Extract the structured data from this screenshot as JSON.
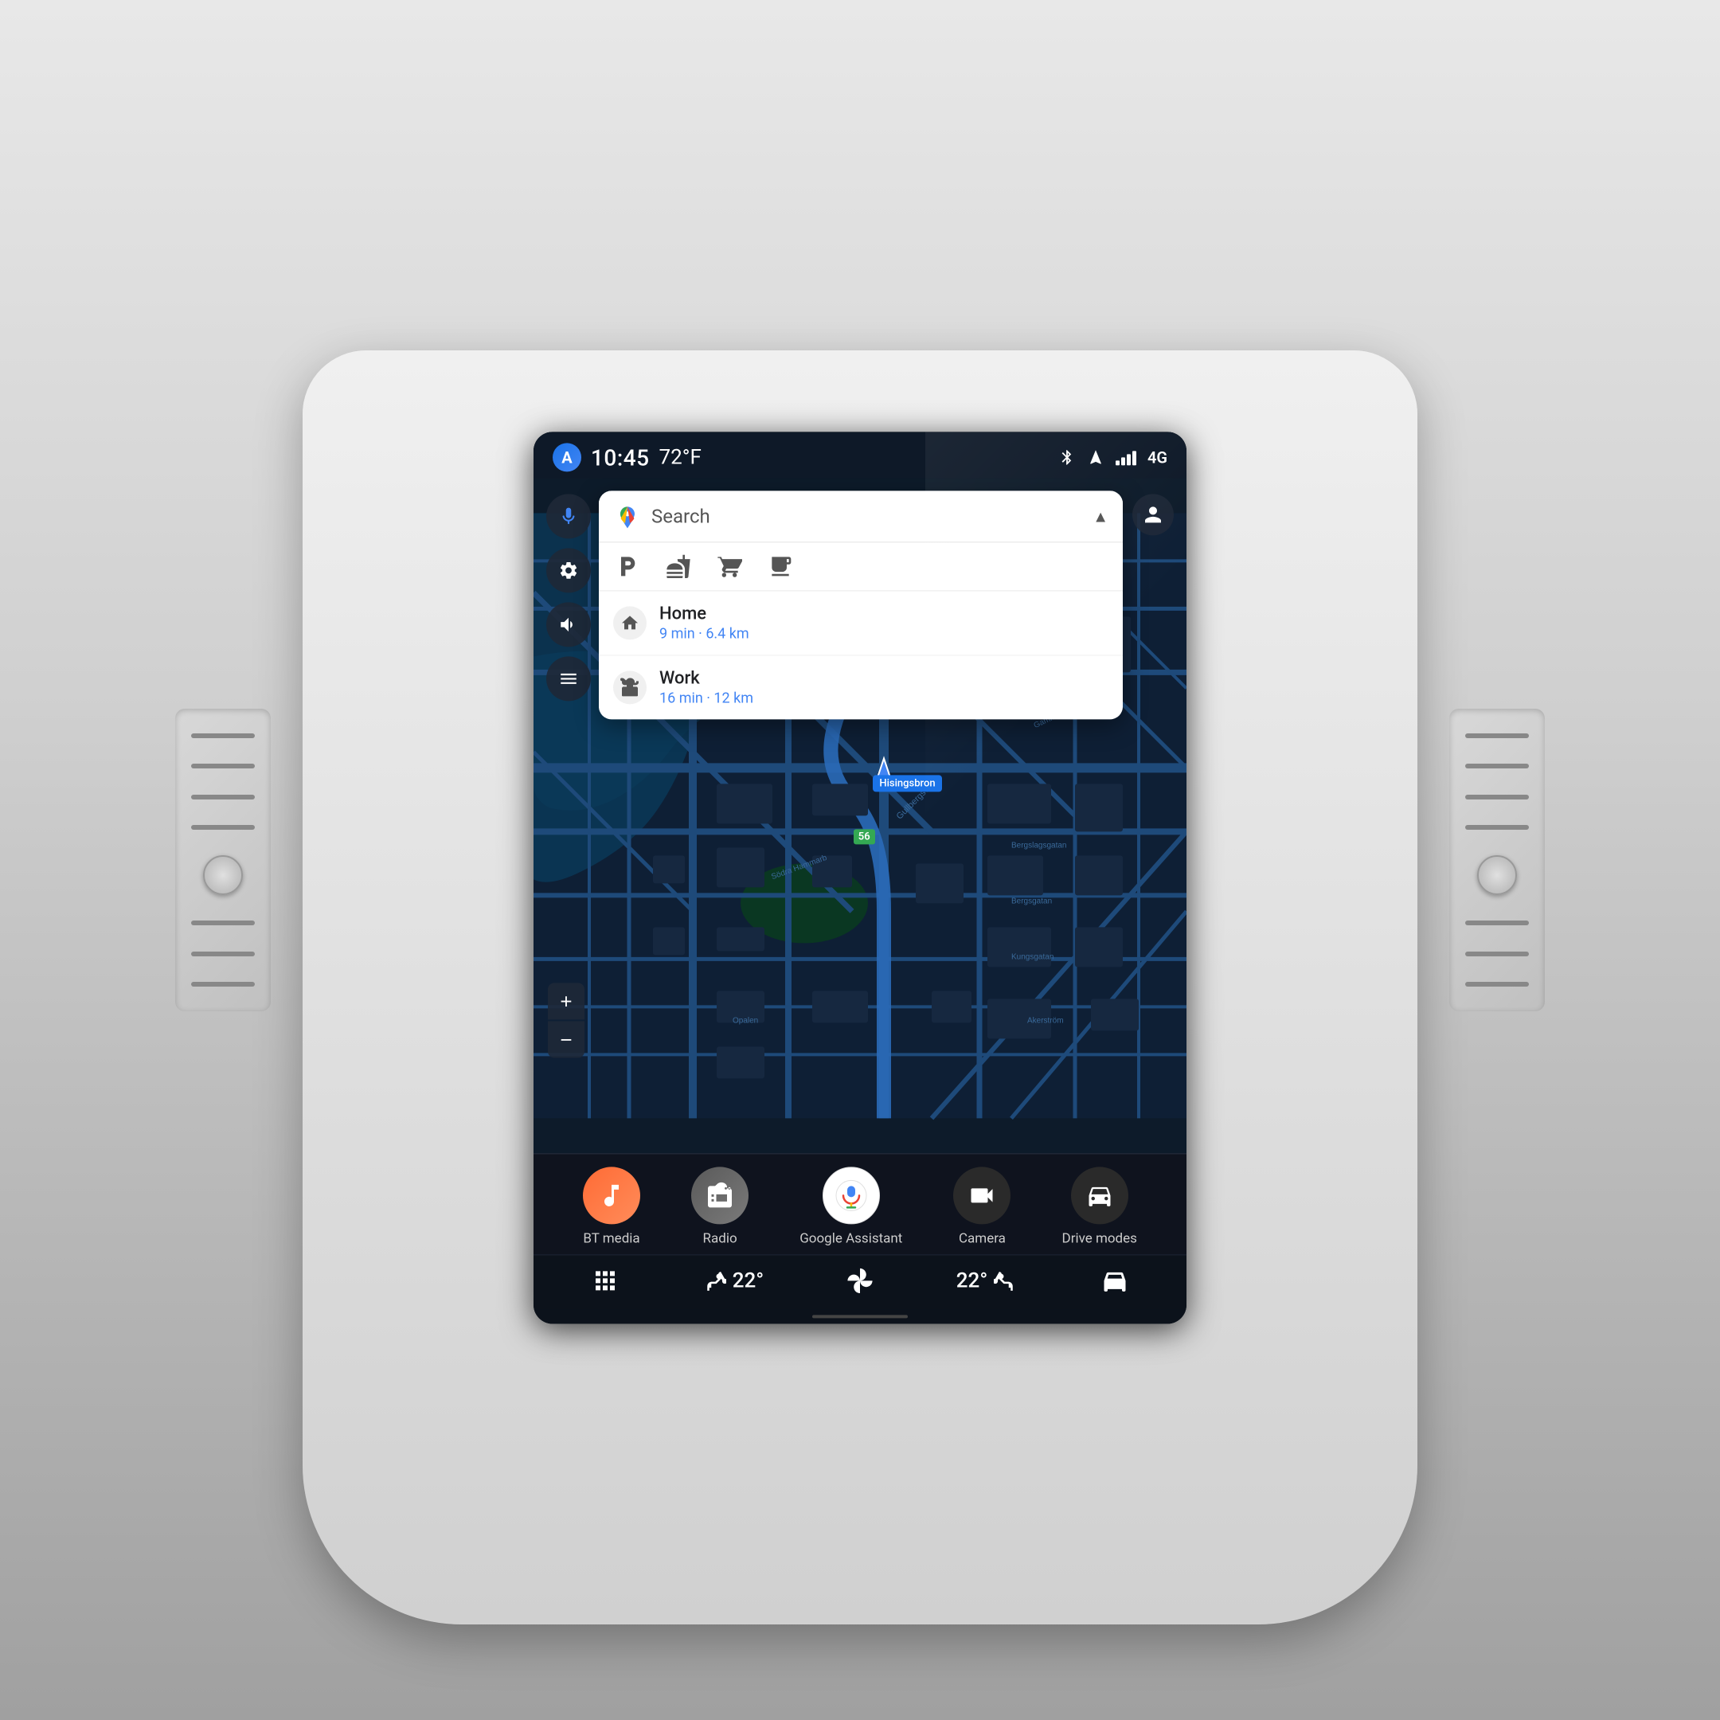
{
  "status_bar": {
    "time": "10:45",
    "temperature": "72°F",
    "network": "4G",
    "bluetooth_icon": "bluetooth",
    "navigation_icon": "navigation-arrow",
    "signal_icon": "signal"
  },
  "search": {
    "placeholder": "Search",
    "label": "Search",
    "chevron": "▲"
  },
  "categories": [
    {
      "id": "parking",
      "icon": "P",
      "label": "Parking"
    },
    {
      "id": "restaurant",
      "icon": "🍴",
      "label": "Restaurant"
    },
    {
      "id": "shopping",
      "icon": "🛒",
      "label": "Shopping"
    },
    {
      "id": "cafe",
      "icon": "☕",
      "label": "Cafe"
    }
  ],
  "destinations": [
    {
      "id": "home",
      "name": "Home",
      "detail": "9 min · 6.4 km",
      "icon": "🏠"
    },
    {
      "id": "work",
      "name": "Work",
      "detail": "16 min · 12 km",
      "icon": "💼"
    }
  ],
  "sidebar_buttons": [
    {
      "id": "mic",
      "icon": "🎤"
    },
    {
      "id": "settings",
      "icon": "⚙"
    },
    {
      "id": "volume",
      "icon": "🔊"
    },
    {
      "id": "navigation",
      "icon": "≡"
    }
  ],
  "map": {
    "bridge_label": "Hisingsbron",
    "green_label": "56"
  },
  "zoom": {
    "in": "+",
    "out": "−"
  },
  "dock": [
    {
      "id": "bt-media",
      "label": "BT media",
      "icon": "♪"
    },
    {
      "id": "radio",
      "label": "Radio",
      "icon": "📻"
    },
    {
      "id": "google-assistant",
      "label": "Google Assistant",
      "icon": "◉"
    },
    {
      "id": "camera",
      "label": "Camera",
      "icon": "📷"
    },
    {
      "id": "drive-modes",
      "label": "Drive modes",
      "icon": "🚗"
    }
  ],
  "controls": [
    {
      "id": "apps",
      "icon": "⊞",
      "label": ""
    },
    {
      "id": "seat-temp-left",
      "icon": "💺",
      "value": "22°",
      "label": "22°"
    },
    {
      "id": "fan",
      "icon": "❋",
      "label": ""
    },
    {
      "id": "seat-temp-right",
      "value": "22°",
      "icon": "💺",
      "label": "22°"
    },
    {
      "id": "car",
      "icon": "🚘",
      "label": ""
    }
  ],
  "colors": {
    "accent_blue": "#4285f4",
    "screen_bg": "#0d1b2a",
    "map_bg": "#0e2040",
    "map_road": "#1a3a6a",
    "map_water": "#0a4a6a",
    "status_bg": "#0f1928",
    "dock_bg": "#0f141e",
    "search_bg": "#ffffff"
  }
}
